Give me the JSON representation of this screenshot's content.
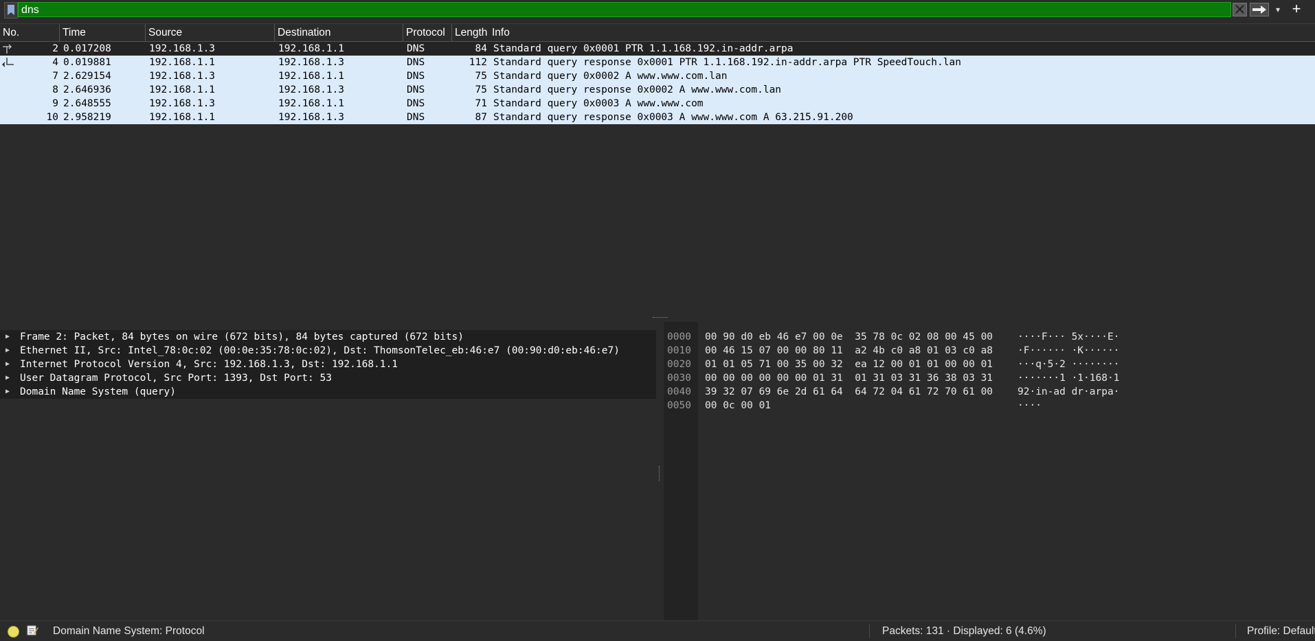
{
  "filter": {
    "value": "dns"
  },
  "packet_list": {
    "columns": [
      "No.",
      "Time",
      "Source",
      "Destination",
      "Protocol",
      "Length",
      "Info"
    ],
    "rows": [
      {
        "no": "2",
        "time": "0.017208",
        "src": "192.168.1.3",
        "dst": "192.168.1.1",
        "proto": "DNS",
        "len": "84",
        "info": "Standard query 0x0001 PTR 1.1.168.192.in-addr.arpa",
        "selected": true,
        "related": "request"
      },
      {
        "no": "4",
        "time": "0.019881",
        "src": "192.168.1.1",
        "dst": "192.168.1.3",
        "proto": "DNS",
        "len": "112",
        "info": "Standard query response 0x0001 PTR 1.1.168.192.in-addr.arpa PTR SpeedTouch.lan",
        "selected": false,
        "related": "response"
      },
      {
        "no": "7",
        "time": "2.629154",
        "src": "192.168.1.3",
        "dst": "192.168.1.1",
        "proto": "DNS",
        "len": "75",
        "info": "Standard query 0x0002 A www.www.com.lan",
        "selected": false,
        "related": ""
      },
      {
        "no": "8",
        "time": "2.646936",
        "src": "192.168.1.1",
        "dst": "192.168.1.3",
        "proto": "DNS",
        "len": "75",
        "info": "Standard query response 0x0002 A www.www.com.lan",
        "selected": false,
        "related": ""
      },
      {
        "no": "9",
        "time": "2.648555",
        "src": "192.168.1.3",
        "dst": "192.168.1.1",
        "proto": "DNS",
        "len": "71",
        "info": "Standard query 0x0003 A www.www.com",
        "selected": false,
        "related": ""
      },
      {
        "no": "10",
        "time": "2.958219",
        "src": "192.168.1.1",
        "dst": "192.168.1.3",
        "proto": "DNS",
        "len": "87",
        "info": "Standard query response 0x0003 A www.www.com A 63.215.91.200",
        "selected": false,
        "related": ""
      }
    ]
  },
  "details": {
    "items": [
      "Frame 2: Packet, 84 bytes on wire (672 bits), 84 bytes captured (672 bits)",
      "Ethernet II, Src: Intel_78:0c:02 (00:0e:35:78:0c:02), Dst: ThomsonTelec_eb:46:e7 (00:90:d0:eb:46:e7)",
      "Internet Protocol Version 4, Src: 192.168.1.3, Dst: 192.168.1.1",
      "User Datagram Protocol, Src Port: 1393, Dst Port: 53",
      "Domain Name System (query)"
    ]
  },
  "bytes": {
    "rows": [
      {
        "offset": "0000",
        "hex": "00 90 d0 eb 46 e7 00 0e  35 78 0c 02 08 00 45 00",
        "ascii": "····F··· 5x····E·"
      },
      {
        "offset": "0010",
        "hex": "00 46 15 07 00 00 80 11  a2 4b c0 a8 01 03 c0 a8",
        "ascii": "·F······ ·K······"
      },
      {
        "offset": "0020",
        "hex": "01 01 05 71 00 35 00 32  ea 12 00 01 01 00 00 01",
        "ascii": "···q·5·2 ········"
      },
      {
        "offset": "0030",
        "hex": "00 00 00 00 00 00 01 31  01 31 03 31 36 38 03 31",
        "ascii": "·······1 ·1·168·1"
      },
      {
        "offset": "0040",
        "hex": "39 32 07 69 6e 2d 61 64  64 72 04 61 72 70 61 00",
        "ascii": "92·in-ad dr·arpa·"
      },
      {
        "offset": "0050",
        "hex": "00 0c 00 01",
        "ascii": "····"
      }
    ]
  },
  "status": {
    "field": "Domain Name System: Protocol",
    "packets": "Packets: 131 · Displayed: 6 (4.6%)",
    "profile": "Profile: Default"
  },
  "icons": {
    "bookmark": "bookmark-icon",
    "clear": "clear-filter-icon",
    "apply": "apply-filter-arrow-icon",
    "expert": "expert-info-icon",
    "comment": "capture-comment-icon"
  },
  "colors": {
    "filter_valid": "#0a7a0a",
    "row_bg": "#dcebfa",
    "selected_row": "#242424"
  }
}
